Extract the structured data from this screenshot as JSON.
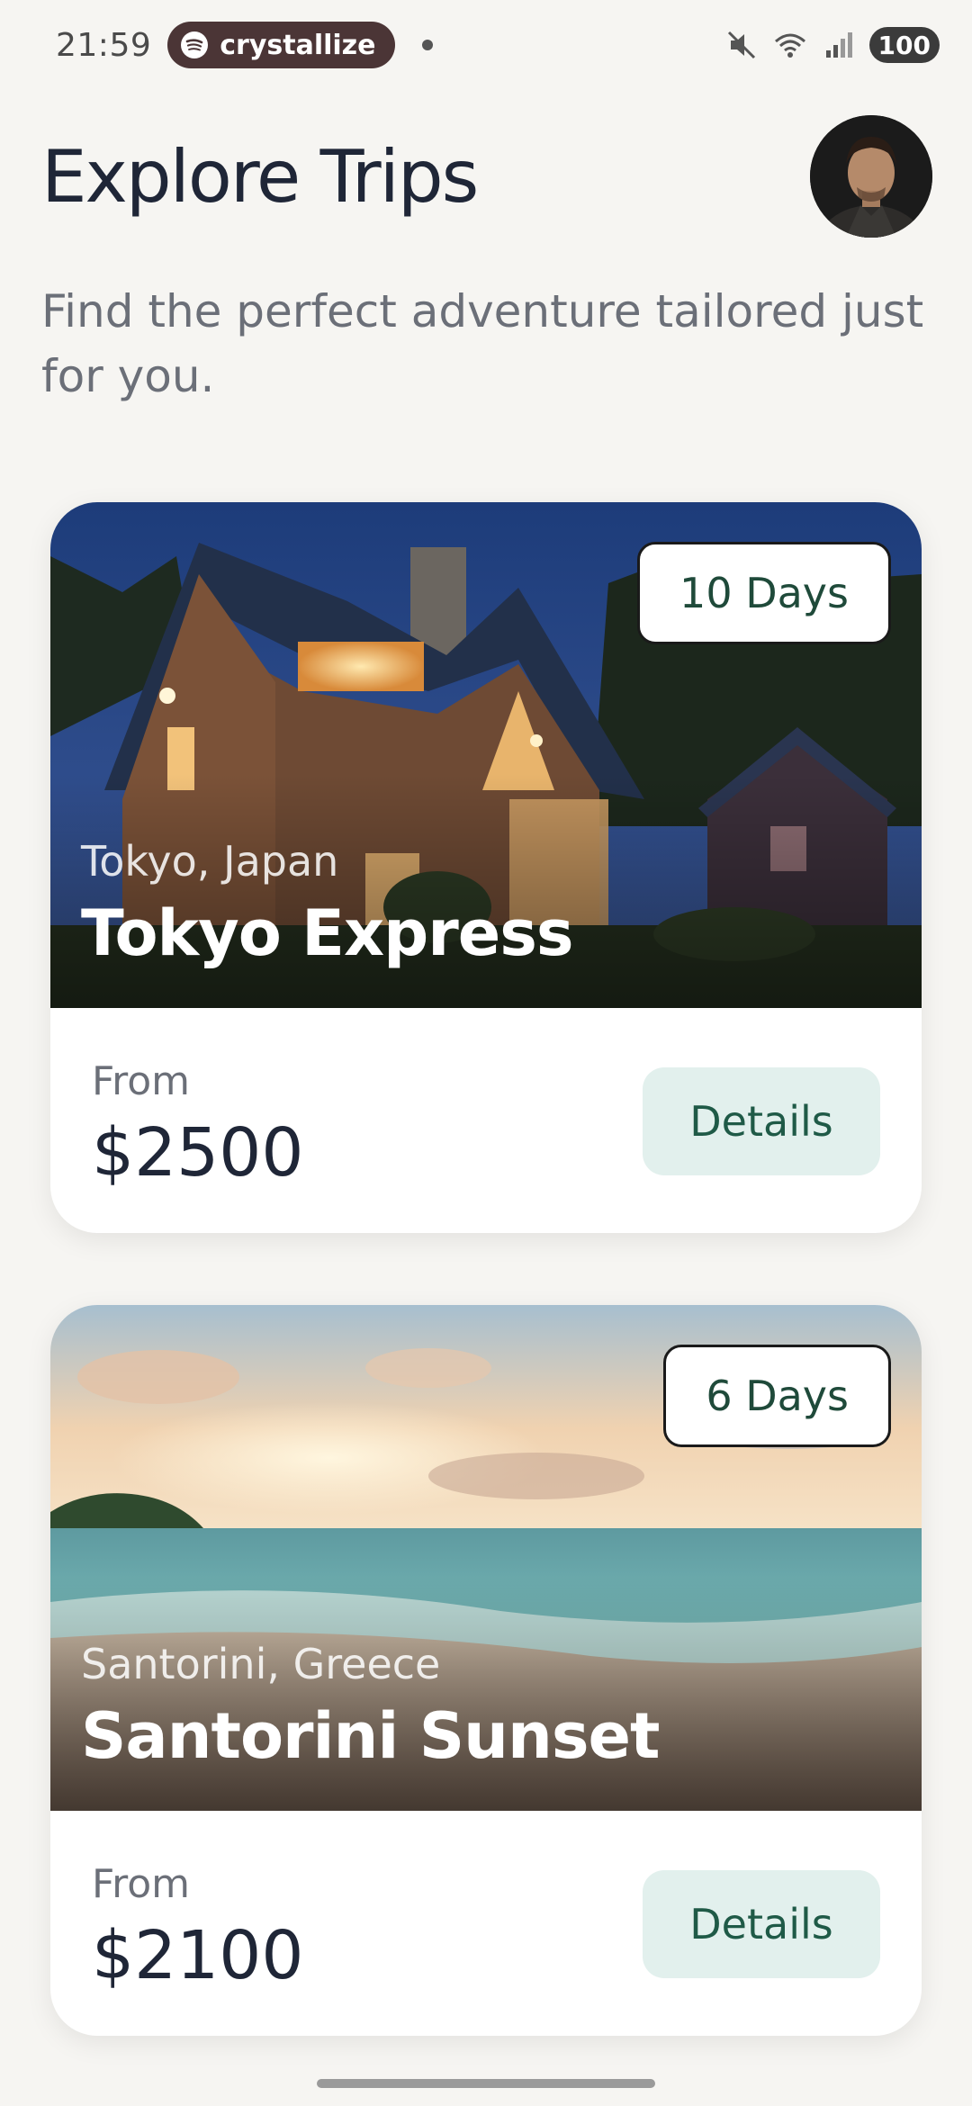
{
  "status_bar": {
    "time": "21:59",
    "media_app": "crystallize",
    "battery": "100",
    "icons": [
      "spotify-icon",
      "mute-icon",
      "wifi-icon",
      "signal-icon",
      "battery-icon"
    ]
  },
  "header": {
    "title": "Explore Trips",
    "subtitle": "Find the perfect adventure tailored just for you."
  },
  "trips": [
    {
      "duration": "10 Days",
      "location": "Tokyo, Japan",
      "name": "Tokyo Express",
      "price_label": "From",
      "price": "$2500",
      "button": "Details",
      "image": "house-photo"
    },
    {
      "duration": "6 Days",
      "location": "Santorini, Greece",
      "name": "Santorini Sunset",
      "price_label": "From",
      "price": "$2100",
      "button": "Details",
      "image": "beach-sunset-photo"
    }
  ],
  "colors": {
    "background": "#f6f5f2",
    "text_primary": "#1f2637",
    "details_button_bg": "#e2f0ed",
    "details_button_text": "#1f5a47",
    "badge_text": "#1f4a3a"
  }
}
